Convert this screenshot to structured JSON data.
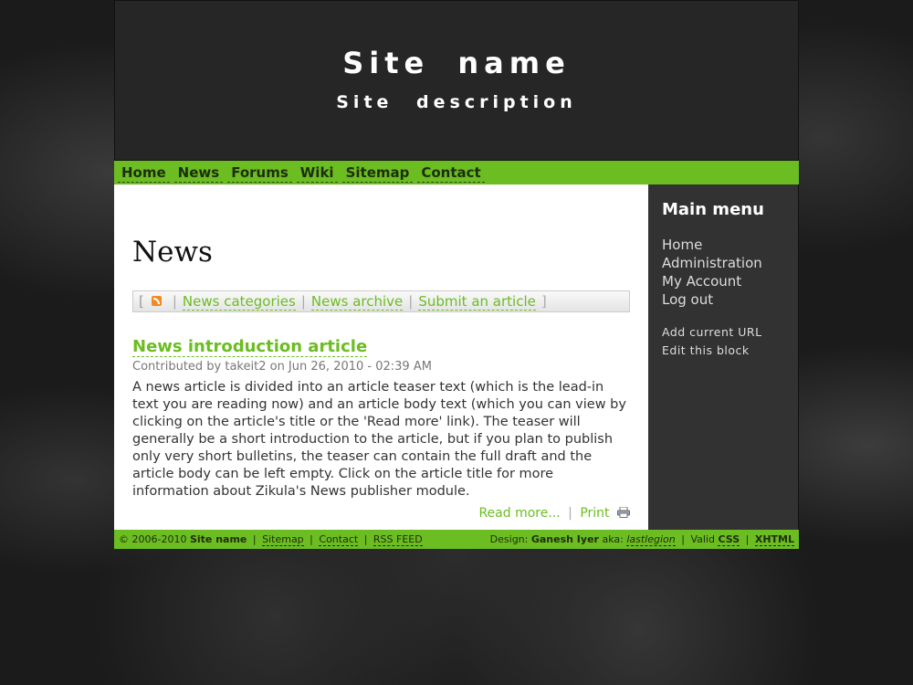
{
  "header": {
    "site_name": "Site name",
    "site_description": "Site description"
  },
  "nav": {
    "items": [
      {
        "label": "Home"
      },
      {
        "label": "News"
      },
      {
        "label": "Forums"
      },
      {
        "label": "Wiki"
      },
      {
        "label": "Sitemap"
      },
      {
        "label": "Contact"
      }
    ]
  },
  "main": {
    "page_title": "News",
    "links_bar": {
      "open_bracket": "[",
      "close_bracket": "]",
      "separator": "|",
      "links": [
        "News categories",
        "News archive",
        "Submit an article"
      ]
    },
    "article": {
      "title": "News introduction article",
      "meta": "Contributed by takeit2 on Jun 26, 2010 - 02:39 AM",
      "body": "A news article is divided into an article teaser text (which is the lead-in text you are reading now) and an article body text (which you can view by clicking on the article's title or the 'Read more' link). The teaser will generally be a short introduction to the article, but if you plan to publish only very short bulletins, the teaser can contain the full draft and the article body can be left empty. Click on the article title for more information about Zikula's News publisher module.",
      "read_more": "Read more...",
      "print": "Print",
      "separator": "|"
    }
  },
  "sidebar": {
    "title": "Main menu",
    "menu": [
      "Home",
      "Administration",
      "My Account",
      "Log out"
    ],
    "tools": [
      "Add current URL",
      "Edit this block"
    ]
  },
  "footer": {
    "copyright": "© 2006-2010",
    "site_name": "Site name",
    "links": [
      "Sitemap",
      "Contact",
      "RSS FEED"
    ],
    "separator": "|",
    "design_label": "Design:",
    "designer": "Ganesh Iyer",
    "aka": "aka:",
    "alias": "lastlegion",
    "valid_label": "Valid",
    "valid_css": "CSS",
    "valid_xhtml": "XHTML"
  },
  "colors": {
    "accent_green": "#6bbd21",
    "header_bg": "#262626",
    "sidebar_bg": "#323232"
  }
}
